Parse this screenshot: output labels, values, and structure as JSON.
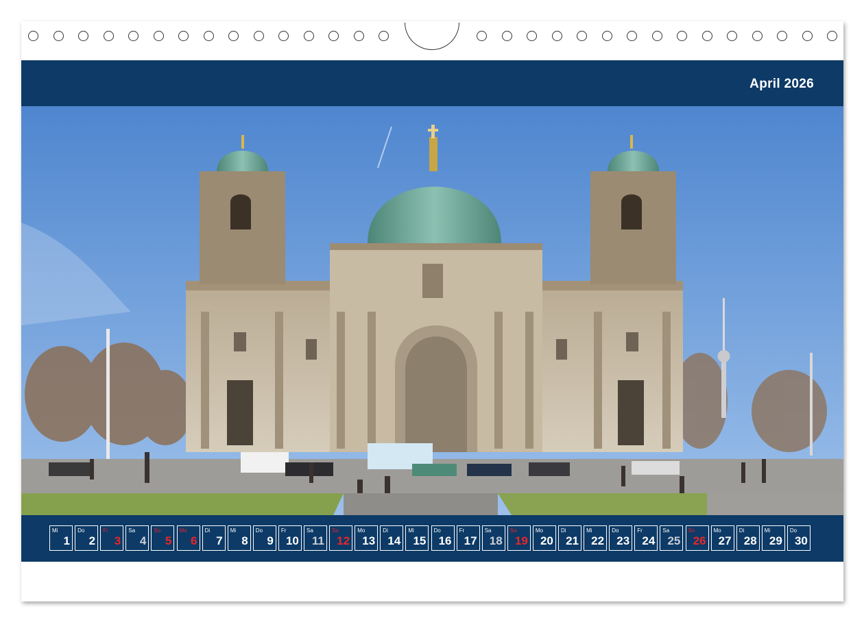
{
  "calendar": {
    "month_label": "April 2026",
    "days": [
      {
        "dow": "Mi",
        "num": "1",
        "kind": "normal"
      },
      {
        "dow": "Do",
        "num": "2",
        "kind": "normal"
      },
      {
        "dow": "Fr",
        "num": "3",
        "kind": "hol"
      },
      {
        "dow": "Sa",
        "num": "4",
        "kind": "sat"
      },
      {
        "dow": "So",
        "num": "5",
        "kind": "sun"
      },
      {
        "dow": "Mo",
        "num": "6",
        "kind": "hol"
      },
      {
        "dow": "Di",
        "num": "7",
        "kind": "normal"
      },
      {
        "dow": "Mi",
        "num": "8",
        "kind": "normal"
      },
      {
        "dow": "Do",
        "num": "9",
        "kind": "normal"
      },
      {
        "dow": "Fr",
        "num": "10",
        "kind": "normal"
      },
      {
        "dow": "Sa",
        "num": "11",
        "kind": "sat"
      },
      {
        "dow": "So",
        "num": "12",
        "kind": "sun"
      },
      {
        "dow": "Mo",
        "num": "13",
        "kind": "normal"
      },
      {
        "dow": "Di",
        "num": "14",
        "kind": "normal"
      },
      {
        "dow": "Mi",
        "num": "15",
        "kind": "normal"
      },
      {
        "dow": "Do",
        "num": "16",
        "kind": "normal"
      },
      {
        "dow": "Fr",
        "num": "17",
        "kind": "normal"
      },
      {
        "dow": "Sa",
        "num": "18",
        "kind": "sat"
      },
      {
        "dow": "So",
        "num": "19",
        "kind": "sun"
      },
      {
        "dow": "Mo",
        "num": "20",
        "kind": "normal"
      },
      {
        "dow": "Di",
        "num": "21",
        "kind": "normal"
      },
      {
        "dow": "Mi",
        "num": "22",
        "kind": "normal"
      },
      {
        "dow": "Do",
        "num": "23",
        "kind": "normal"
      },
      {
        "dow": "Fr",
        "num": "24",
        "kind": "normal"
      },
      {
        "dow": "Sa",
        "num": "25",
        "kind": "sat"
      },
      {
        "dow": "So",
        "num": "26",
        "kind": "sun"
      },
      {
        "dow": "Mo",
        "num": "27",
        "kind": "normal"
      },
      {
        "dow": "Di",
        "num": "28",
        "kind": "normal"
      },
      {
        "dow": "Mi",
        "num": "29",
        "kind": "normal"
      },
      {
        "dow": "Do",
        "num": "30",
        "kind": "normal"
      }
    ]
  },
  "colors": {
    "banner": "#0d3a66",
    "holiday_red": "#e8262b",
    "sky": "#5b8fd4",
    "dome_green": "#5f9a8a"
  },
  "photo_subject": "cathedral-with-domes-and-tv-tower"
}
